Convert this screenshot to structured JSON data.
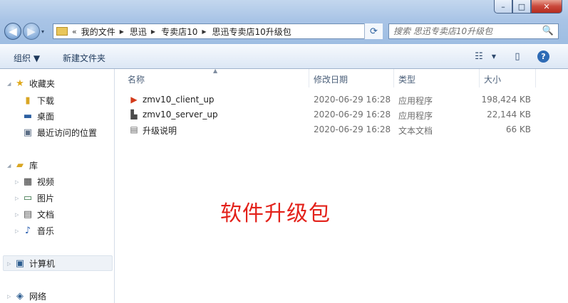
{
  "window": {
    "controls": {
      "minimize": "–",
      "maximize": "□",
      "close": "✕"
    }
  },
  "nav": {
    "back_icon": "arrow-left-icon",
    "forward_icon": "arrow-right-icon",
    "history_dropdown": "▾"
  },
  "address": {
    "overflow": "«",
    "breadcrumbs": [
      "我的文件",
      "思迅",
      "专卖店10",
      "思迅专卖店10升级包"
    ],
    "separator": "▶",
    "dropdown": "▼",
    "refresh": "⟳"
  },
  "search": {
    "placeholder": "搜索 思迅专卖店10升级包",
    "icon": "🔍"
  },
  "toolbar": {
    "organize": "组织 ▼",
    "new_folder": "新建文件夹",
    "view_icon": "☷",
    "view_dropdown": "▼",
    "preview_icon": "▯",
    "help": "?"
  },
  "sidebar": {
    "favorites": {
      "title": "收藏夹",
      "items": [
        "下载",
        "桌面",
        "最近访问的位置"
      ]
    },
    "libraries": {
      "title": "库",
      "items": [
        "视频",
        "图片",
        "文档",
        "音乐"
      ]
    },
    "computer": "计算机",
    "network": "网络"
  },
  "columns": {
    "name": "名称",
    "modified": "修改日期",
    "type": "类型",
    "size": "大小"
  },
  "files": [
    {
      "name": "zmv10_client_up",
      "modified": "2020-06-29 16:28",
      "type": "应用程序",
      "size": "198,424 KB",
      "icon": "red-play-app-icon"
    },
    {
      "name": "zmv10_server_up",
      "modified": "2020-06-29 16:28",
      "type": "应用程序",
      "size": "22,144 KB",
      "icon": "server-app-icon"
    },
    {
      "name": "升级说明",
      "modified": "2020-06-29 16:28",
      "type": "文本文档",
      "size": "66 KB",
      "icon": "text-document-icon"
    }
  ],
  "overlay_text": "软件升级包",
  "colors": {
    "overlay": "#e3211a",
    "titlebar": "#a9c4e6",
    "close_button": "#c9473a"
  }
}
